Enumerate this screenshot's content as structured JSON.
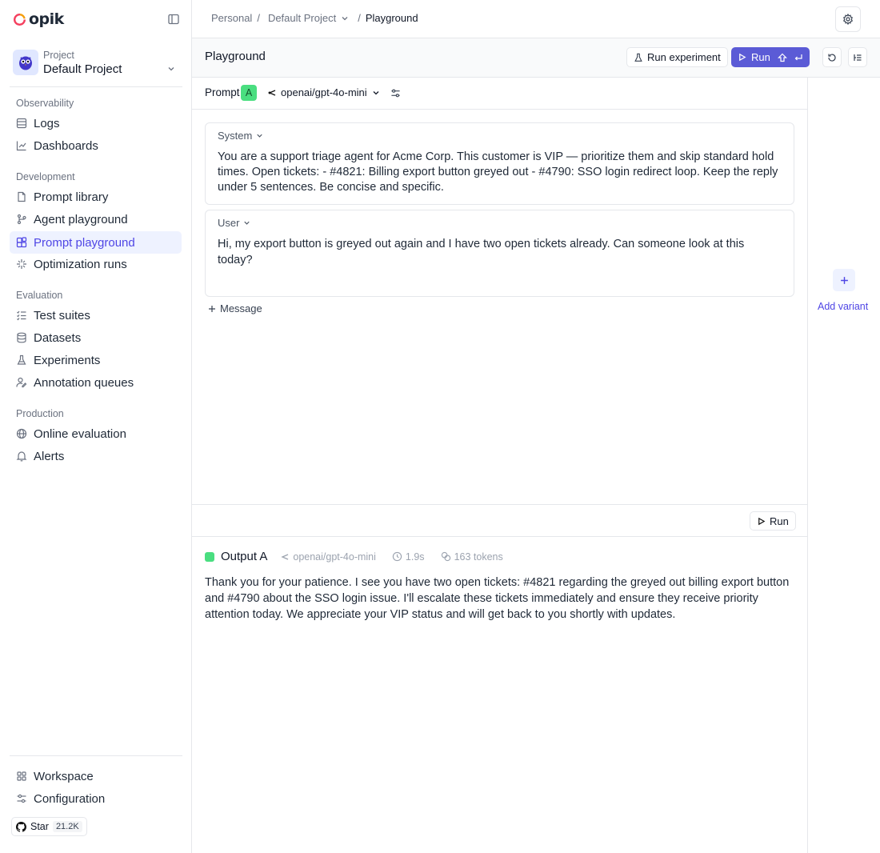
{
  "app": {
    "logo_text": "opik"
  },
  "sidebar": {
    "project_label": "Project",
    "project_name": "Default Project",
    "sections": [
      {
        "label": "Observability",
        "items": [
          {
            "label": "Logs",
            "icon": "logs-icon"
          },
          {
            "label": "Dashboards",
            "icon": "chart-line-icon"
          }
        ]
      },
      {
        "label": "Development",
        "items": [
          {
            "label": "Prompt library",
            "icon": "file-icon"
          },
          {
            "label": "Agent playground",
            "icon": "branch-icon"
          },
          {
            "label": "Prompt playground",
            "icon": "blocks-icon",
            "active": true
          },
          {
            "label": "Optimization runs",
            "icon": "sparkles-icon"
          }
        ]
      },
      {
        "label": "Evaluation",
        "items": [
          {
            "label": "Test suites",
            "icon": "list-check-icon"
          },
          {
            "label": "Datasets",
            "icon": "database-icon"
          },
          {
            "label": "Experiments",
            "icon": "flask-icon"
          },
          {
            "label": "Annotation queues",
            "icon": "user-pen-icon"
          }
        ]
      },
      {
        "label": "Production",
        "items": [
          {
            "label": "Online evaluation",
            "icon": "globe-icon"
          },
          {
            "label": "Alerts",
            "icon": "bell-icon"
          }
        ]
      }
    ],
    "bottom": [
      {
        "label": "Workspace",
        "icon": "grid-icon"
      },
      {
        "label": "Configuration",
        "icon": "sliders-icon"
      }
    ],
    "github": {
      "label": "Star",
      "count": "21.2K"
    }
  },
  "breadcrumb": {
    "workspace": "Personal",
    "project": "Default Project",
    "page": "Playground"
  },
  "header": {
    "title": "Playground",
    "run_experiment_label": "Run experiment",
    "run_label": "Run"
  },
  "prompt": {
    "label": "Prompt",
    "badge": "A",
    "model": "openai/gpt-4o-mini",
    "messages": [
      {
        "role": "System",
        "text": "You are a support triage agent for Acme Corp. This customer is VIP — prioritize them and skip standard hold times. Open tickets: - #4821: Billing export button greyed out - #4790: SSO login redirect loop. Keep the reply under 5 sentences. Be concise and specific."
      },
      {
        "role": "User",
        "text": "Hi, my export button is greyed out again and I have two open tickets already. Can someone look at this today?"
      }
    ],
    "add_message_label": "Message",
    "run_label": "Run"
  },
  "output": {
    "title": "Output A",
    "model": "openai/gpt-4o-mini",
    "duration": "1.9s",
    "tokens": "163 tokens",
    "text": "Thank you for your patience. I see you have two open tickets: #4821 regarding the greyed out billing export button and #4790 about the SSO login issue. I'll escalate these tickets immediately and ensure they receive priority attention today. We appreciate your VIP status and will get back to you shortly with updates."
  },
  "variant": {
    "add_label": "Add variant"
  },
  "colors": {
    "accent": "#5b5bd6",
    "active_bg": "#eef2ff",
    "output_badge": "#4ade80"
  }
}
